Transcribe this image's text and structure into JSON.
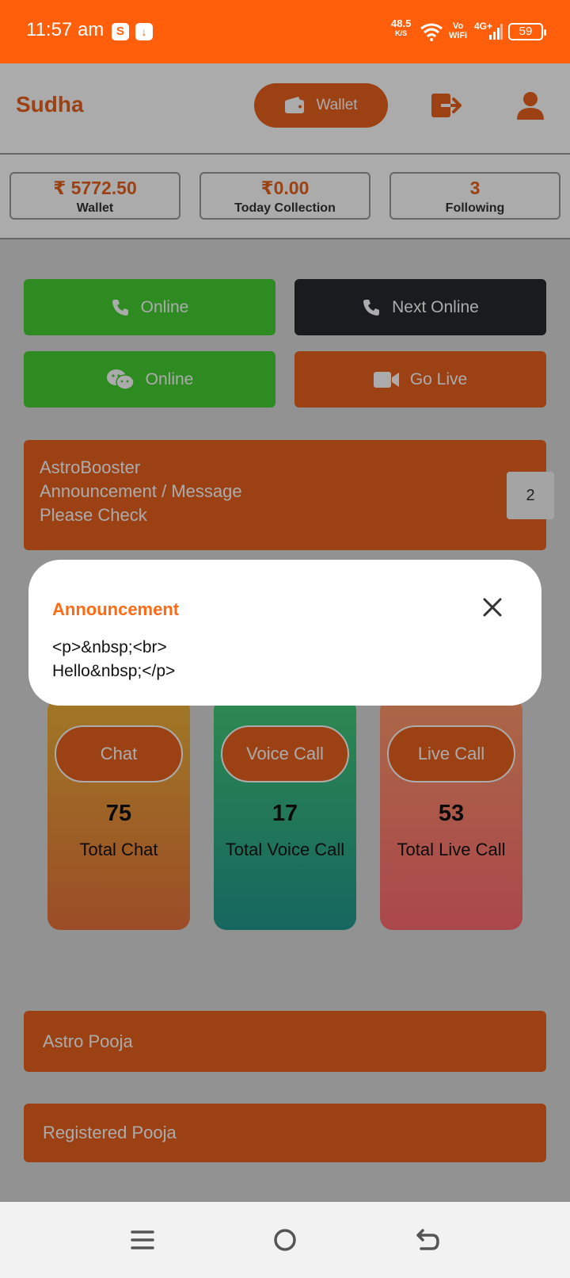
{
  "status_bar": {
    "time": "11:57 am",
    "app_icon_1": "S",
    "net_speed": "48.5",
    "net_unit": "K/S",
    "vowifi_top": "Vo",
    "vowifi_bottom": "WiFi",
    "network": "4G+",
    "battery": "59"
  },
  "header": {
    "brand": "Sudha",
    "wallet_label": "Wallet"
  },
  "stats": [
    {
      "value": "₹ 5772.50",
      "label": "Wallet"
    },
    {
      "value": "₹0.00",
      "label": "Today Collection"
    },
    {
      "value": "3",
      "label": "Following"
    }
  ],
  "actions": {
    "call_online": "Online",
    "next_online": "Next Online",
    "chat_online": "Online",
    "go_live": "Go Live"
  },
  "announcement_card": {
    "line1": "AstroBooster",
    "line2": "Announcement / Message",
    "line3": "Please Check",
    "count": "2"
  },
  "services": [
    {
      "button": "Chat",
      "count": "75",
      "label": "Total Chat"
    },
    {
      "button": "Voice Call",
      "count": "17",
      "label": "Total Voice Call"
    },
    {
      "button": "Live Call",
      "count": "53",
      "label": "Total Live Call"
    }
  ],
  "bottom_bars": {
    "astro_pooja": "Astro Pooja",
    "registered_pooja": "Registered Pooja"
  },
  "dialog": {
    "title": "Announcement",
    "body": "<p>&nbsp;<br>\nHello&nbsp;</p>"
  },
  "colors": {
    "status_bar": "#ff5f0a",
    "accent": "#e8611e",
    "online_green": "#43d033",
    "dark_button": "#26292e"
  }
}
